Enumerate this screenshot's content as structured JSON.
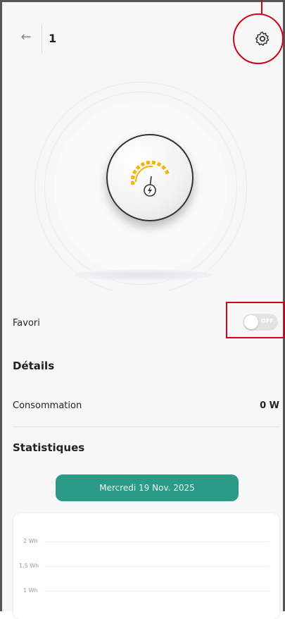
{
  "header": {
    "title": "1"
  },
  "icons": {
    "back": "arrow-left-icon",
    "settings": "gear-icon"
  },
  "favorite": {
    "label": "Favori",
    "toggle_state_text": "OFF"
  },
  "details": {
    "heading": "Détails",
    "consumption_label": "Consommation",
    "consumption_value": "0 W"
  },
  "stats": {
    "heading": "Statistiques",
    "date_label": "Mercredi 19 Nov. 2025"
  },
  "chart_data": {
    "type": "bar",
    "y_ticks": [
      "2 Wh",
      "1.5 Wh",
      "1 Wh"
    ],
    "ylim": [
      0,
      2
    ]
  },
  "colors": {
    "accent": "#2b9b87",
    "annotation": "#d0021b",
    "gauge": "#f5b400"
  }
}
